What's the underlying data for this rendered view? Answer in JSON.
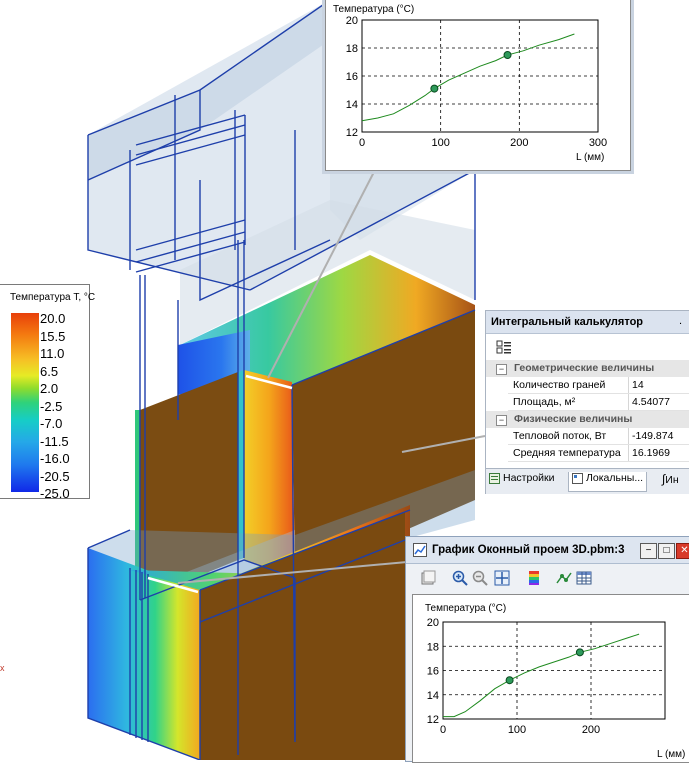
{
  "legend": {
    "title": "Температура T, °C",
    "values": [
      "20.0",
      "15.5",
      "11.0",
      "6.5",
      "2.0",
      "-2.5",
      "-7.0",
      "-11.5",
      "-16.0",
      "-20.5",
      "-25.0"
    ]
  },
  "top_chart": {
    "ylabel": "Температура (°C)",
    "xlabel": "L (мм)",
    "yticks": [
      "12",
      "14",
      "16",
      "18",
      "20"
    ],
    "xticks": [
      "0",
      "100",
      "200",
      "300"
    ],
    "line_color": "#1e8a1e",
    "marker_color": "#2e9a5a"
  },
  "calculator": {
    "title": "Интегральный калькулятор",
    "close_glyph": ".",
    "groups": [
      {
        "label": "Геометрические величины",
        "toggle": "−",
        "rows": [
          {
            "key": "Количество граней",
            "value": "14"
          },
          {
            "key": "Площадь, м²",
            "value": "4.54077"
          }
        ]
      },
      {
        "label": "Физические величины",
        "toggle": "−",
        "rows": [
          {
            "key": "Тепловой поток, Вт",
            "value": "-149.874"
          },
          {
            "key": "Средняя температура",
            "value": "16.1969"
          }
        ]
      }
    ],
    "tabs": [
      "Настройки",
      "Локальны...",
      "Ин"
    ]
  },
  "graph_window": {
    "title": "График Оконный проем 3D.pbm:3",
    "buttons": [
      "−",
      "□",
      "✕"
    ],
    "ylabel": "Температура (°C)",
    "xlabel": "L (мм)",
    "yticks": [
      "12",
      "14",
      "16",
      "18",
      "20"
    ],
    "xticks": [
      "0",
      "100",
      "200"
    ]
  },
  "chart_data": [
    {
      "type": "line",
      "title": "",
      "xlabel": "L (мм)",
      "ylabel": "Температура (°C)",
      "xlim": [
        0,
        300
      ],
      "ylim": [
        12,
        20
      ],
      "grid": true,
      "series": [
        {
          "x": [
            0,
            20,
            40,
            60,
            80,
            92,
            110,
            130,
            150,
            170,
            185,
            205,
            225,
            250,
            270
          ],
          "y": [
            12.8,
            13.0,
            13.3,
            13.9,
            14.6,
            15.1,
            15.7,
            16.2,
            16.7,
            17.1,
            17.5,
            17.8,
            18.2,
            18.6,
            19.0
          ]
        }
      ],
      "markers": {
        "x": [
          92,
          185
        ],
        "y": [
          15.1,
          17.5
        ]
      }
    },
    {
      "type": "line",
      "title": "",
      "xlabel": "L (мм)",
      "ylabel": "Температура (°C)",
      "xlim": [
        0,
        300
      ],
      "ylim": [
        12,
        20
      ],
      "grid": true,
      "series": [
        {
          "x": [
            0,
            15,
            30,
            50,
            70,
            90,
            110,
            130,
            150,
            170,
            185,
            205,
            225,
            250,
            265
          ],
          "y": [
            12.2,
            12.2,
            12.6,
            13.5,
            14.5,
            15.2,
            15.8,
            16.3,
            16.7,
            17.1,
            17.5,
            17.8,
            18.2,
            18.7,
            19.0
          ]
        }
      ],
      "markers": {
        "x": [
          90,
          185
        ],
        "y": [
          15.2,
          17.5
        ]
      }
    }
  ]
}
